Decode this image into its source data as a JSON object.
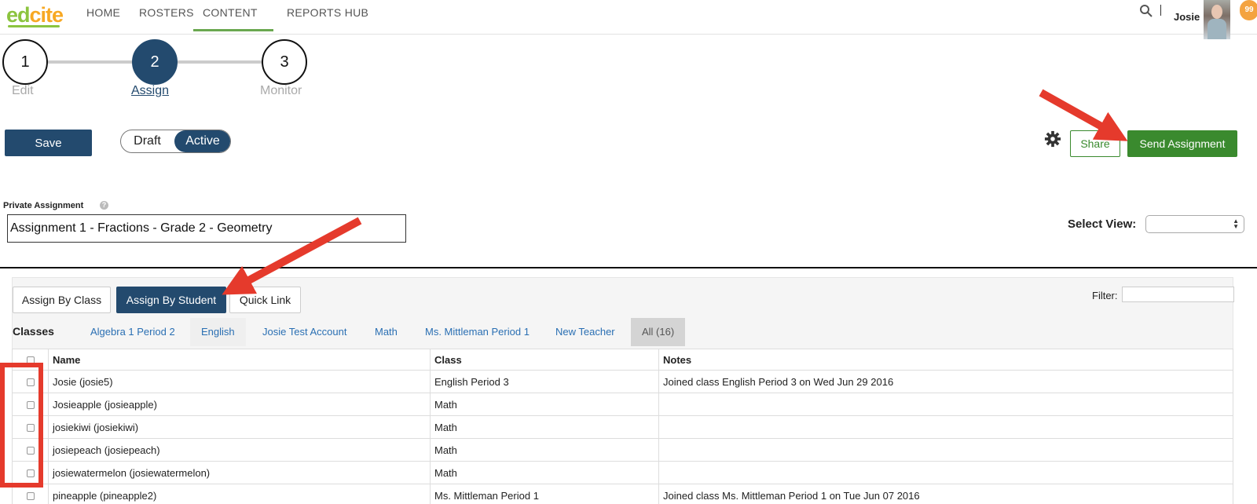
{
  "nav": {
    "logo_part1": "ed",
    "logo_part2": "cite",
    "items": [
      "HOME",
      "ROSTERS",
      "CONTENT",
      "REPORTS HUB"
    ],
    "user_name": "Josie",
    "badge_count": "99"
  },
  "stepper": {
    "steps": [
      {
        "number": "1",
        "label": "Edit"
      },
      {
        "number": "2",
        "label": "Assign"
      },
      {
        "number": "3",
        "label": "Monitor"
      }
    ],
    "active_step": 2
  },
  "actions": {
    "save_label": "Save",
    "toggle_draft": "Draft",
    "toggle_active": "Active",
    "share_label": "Share",
    "send_label": "Send Assignment"
  },
  "assignment": {
    "private_label": "Private Assignment",
    "help_glyph": "?",
    "name_value": "Assignment 1 - Fractions - Grade 2 - Geometry",
    "select_view_label": "Select View:",
    "select_view_value": ""
  },
  "panel": {
    "tabs": [
      "Assign By Class",
      "Assign By Student",
      "Quick Link"
    ],
    "active_tab": "Assign By Student",
    "filter_label": "Filter:",
    "filter_value": "",
    "classes_label": "Classes",
    "class_tabs": [
      "Algebra 1 Period 2",
      "English",
      "Josie Test Account",
      "Math",
      "Ms. Mittleman Period 1",
      "New Teacher",
      "All (16)"
    ]
  },
  "table": {
    "headers": [
      "Name",
      "Class",
      "Notes"
    ],
    "rows": [
      {
        "name": "Josie (josie5)",
        "class": "English Period 3",
        "notes": "Joined class English Period 3 on Wed Jun 29 2016"
      },
      {
        "name": "Josieapple (josieapple)",
        "class": "Math",
        "notes": ""
      },
      {
        "name": "josiekiwi (josiekiwi)",
        "class": "Math",
        "notes": ""
      },
      {
        "name": "josiepeach (josiepeach)",
        "class": "Math",
        "notes": ""
      },
      {
        "name": "josiewatermelon (josiewatermelon)",
        "class": "Math",
        "notes": ""
      },
      {
        "name": "pineapple (pineapple2)",
        "class": "Ms. Mittleman Period 1",
        "notes": "Joined class Ms. Mittleman Period 1 on Tue Jun 07 2016"
      }
    ]
  },
  "colors": {
    "primary": "#234a6e",
    "green": "#3a8a2e",
    "annotation_red": "#e53a2c",
    "link": "#2a6fb3"
  },
  "icons": {
    "search": "search-icon",
    "gear": "gear-icon",
    "help": "help-icon"
  }
}
